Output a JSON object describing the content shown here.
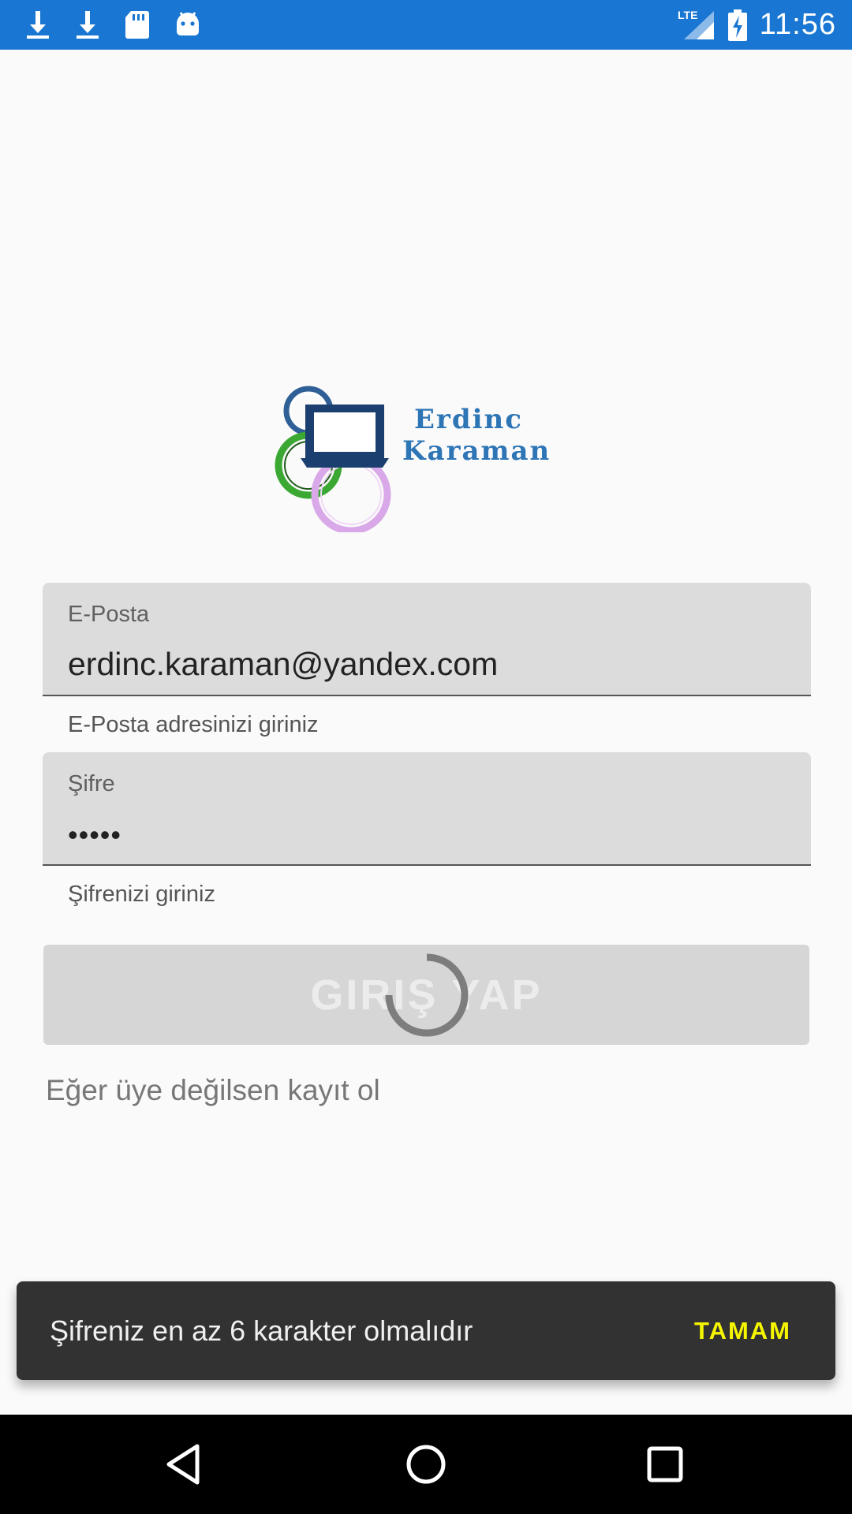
{
  "status_bar": {
    "time": "11:56",
    "network": "LTE",
    "left_icons": [
      "download-icon",
      "download-icon",
      "sd-card-icon",
      "android-icon"
    ],
    "background": "#1976d2"
  },
  "logo": {
    "line1": "Erdinc",
    "line2": "Karaman"
  },
  "email_field": {
    "label": "E-Posta",
    "value": "erdinc.karaman@yandex.com",
    "helper": "E-Posta adresinizi giriniz"
  },
  "password_field": {
    "label": "Şifre",
    "value": "•••••",
    "helper": "Şifrenizi giriniz"
  },
  "login_button": {
    "label": "GIRIŞ YAP"
  },
  "register_link": "Eğer üye değilsen kayıt ol",
  "snackbar": {
    "message": "Şifreniz en az 6 karakter olmalıdır",
    "action": "TAMAM",
    "action_color": "#f5f500"
  },
  "nav_bar": {
    "icons": [
      "back-icon",
      "home-icon",
      "recents-icon"
    ]
  }
}
